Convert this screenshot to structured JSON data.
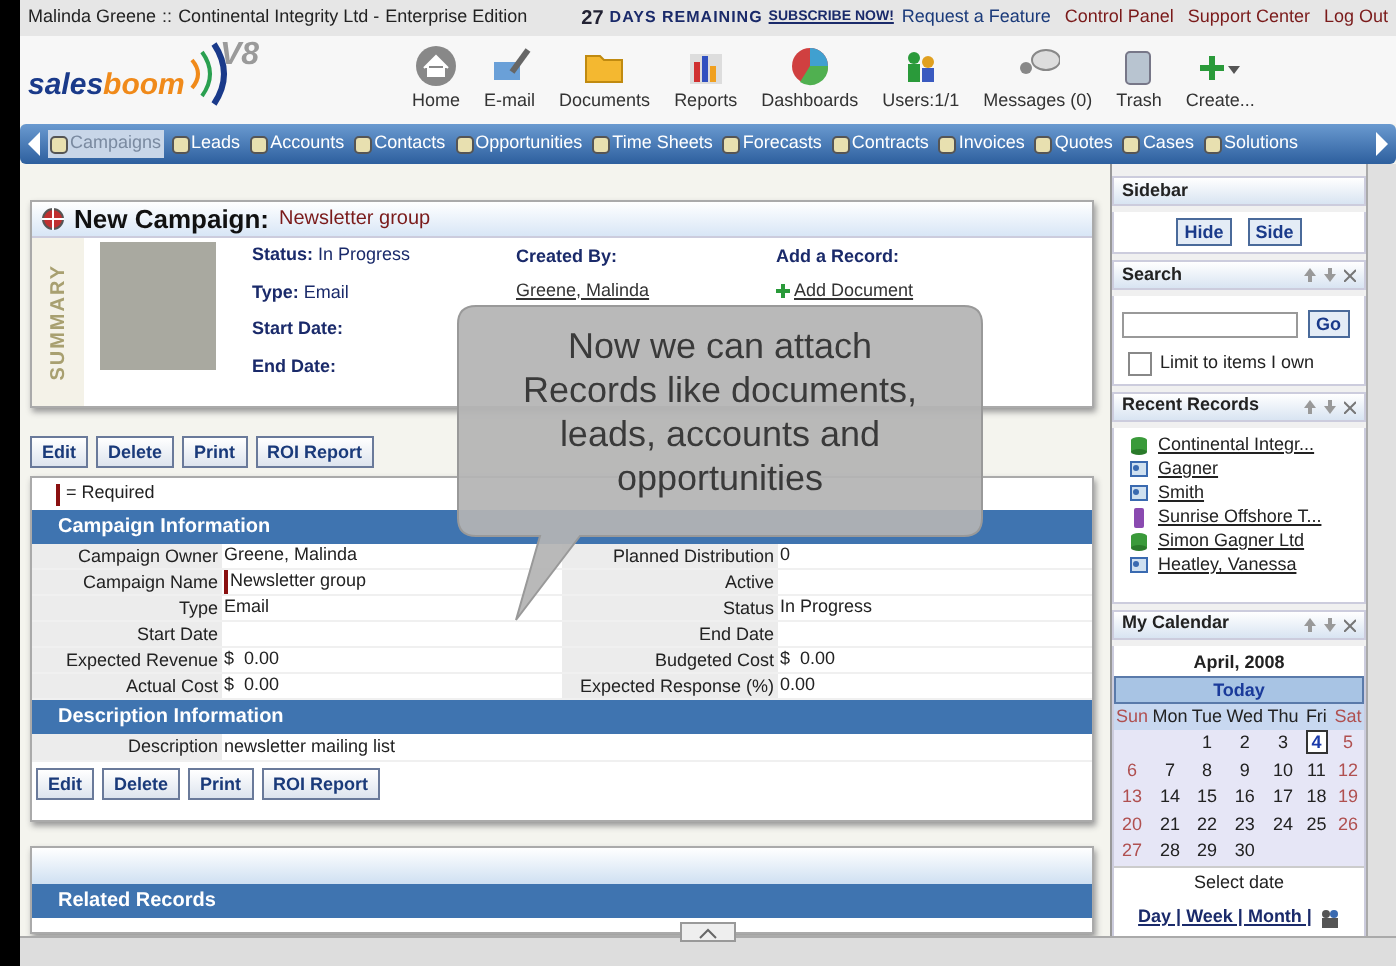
{
  "top_bar": {
    "user": "Malinda Greene",
    "separator": "::",
    "company": "Continental Integrity Ltd -",
    "edition": "Enterprise Edition",
    "trial_days": "27",
    "trial_label": "DAYS REMAINING",
    "subscribe": "SUBSCRIBE NOW!",
    "links": [
      {
        "label": "Request a Feature",
        "color": "#1a3a7a"
      },
      {
        "label": "Control Panel",
        "color": "#7a1a1a"
      },
      {
        "label": "Support Center",
        "color": "#7a1a1a"
      },
      {
        "label": "Log Out",
        "color": "#7a1a1a"
      }
    ]
  },
  "logo": {
    "watermark": "V8",
    "part_1": "sales",
    "part_2": "boom"
  },
  "toolbar": [
    {
      "kind": "home",
      "label": "Home"
    },
    {
      "kind": "email",
      "label": "E-mail"
    },
    {
      "kind": "folder",
      "label": "Documents"
    },
    {
      "kind": "bars",
      "label": "Reports"
    },
    {
      "kind": "pie",
      "label": "Dashboards"
    },
    {
      "kind": "users",
      "label": "Users:1/1"
    },
    {
      "kind": "messages",
      "label": "Messages (0)"
    },
    {
      "kind": "trash",
      "label": "Trash"
    },
    {
      "kind": "create",
      "label": "Create..."
    }
  ],
  "nav_tabs": [
    {
      "label": "Campaigns",
      "selected": true
    },
    {
      "label": "Leads",
      "selected": false
    },
    {
      "label": "Accounts",
      "selected": false
    },
    {
      "label": "Contacts",
      "selected": false
    },
    {
      "label": "Opportunities",
      "selected": false
    },
    {
      "label": "Time Sheets",
      "selected": false
    },
    {
      "label": "Forecasts",
      "selected": false
    },
    {
      "label": "Contracts",
      "selected": false
    },
    {
      "label": "Invoices",
      "selected": false
    },
    {
      "label": "Quotes",
      "selected": false
    },
    {
      "label": "Cases",
      "selected": false
    },
    {
      "label": "Solutions",
      "selected": false
    }
  ],
  "campaign": {
    "title": "New Campaign:",
    "name": "Newsletter group",
    "summary_label": "SUMMARY",
    "fields": [
      {
        "label": "Status:",
        "value": "In Progress"
      },
      {
        "label": "Type:",
        "value": "Email"
      },
      {
        "label": "Start Date:"
      },
      {
        "label": "End Date:"
      }
    ],
    "created_by_label": "Created By:",
    "created_by": "Greene, Malinda",
    "add_record_label": "Add a Record:",
    "add_record_links": [
      "Add Document"
    ]
  },
  "action_buttons_top": [
    "Edit",
    "Delete",
    "Print",
    "ROI Report"
  ],
  "required_note": "= Required",
  "campaign_information": {
    "title": "Campaign Information",
    "rows": [
      {
        "left": {
          "label": "Campaign Owner",
          "value": "Greene, Malinda",
          "required": false
        },
        "right": {
          "label": "Planned Distribution",
          "value": "0",
          "required": false
        }
      },
      {
        "left": {
          "label": "Campaign Name",
          "value": "Newsletter group",
          "required": true
        },
        "right": {
          "label": "Active",
          "required": false
        }
      },
      {
        "left": {
          "label": "Type",
          "value": "Email",
          "required": false
        },
        "right": {
          "label": "Status",
          "value": "In Progress",
          "required": false
        }
      },
      {
        "left": {
          "label": "Start Date",
          "required": false
        },
        "right": {
          "label": "End Date",
          "required": false
        }
      },
      {
        "left": {
          "label": "Expected Revenue",
          "value": "$  0.00",
          "required": false
        },
        "right": {
          "label": "Budgeted Cost",
          "value": "$  0.00",
          "required": false
        }
      },
      {
        "left": {
          "label": "Actual Cost",
          "value": "$  0.00",
          "required": false
        },
        "right": {
          "label": "Expected Response (%)",
          "value": "0.00",
          "required": false
        }
      }
    ]
  },
  "description_information": {
    "title": "Description Information",
    "rows": [
      {
        "label": "Description",
        "value": "newsletter mailing list"
      }
    ]
  },
  "action_buttons_bottom": [
    "Edit",
    "Delete",
    "Print",
    "ROI Report"
  ],
  "related_records": {
    "title": "Related Records"
  },
  "callout": "Now we can attach Records like documents, leads, accounts and opportunities",
  "sidebar": {
    "title": "Sidebar",
    "buttons": [
      "Hide",
      "Side"
    ],
    "search": {
      "title": "Search",
      "button": "Go",
      "checkbox_label": "Limit to items I own",
      "checked": false
    },
    "recent_records": {
      "title": "Recent Records",
      "items": [
        {
          "kind": "account",
          "label": "Continental Integr..."
        },
        {
          "kind": "contact",
          "label": "Gagner"
        },
        {
          "kind": "contact",
          "label": "Smith"
        },
        {
          "kind": "opportunity",
          "label": "Sunrise Offshore T..."
        },
        {
          "kind": "account",
          "label": "Simon Gagner Ltd"
        },
        {
          "kind": "contact",
          "label": "Heatley, Vanessa"
        }
      ]
    },
    "calendar": {
      "title": "My Calendar",
      "month": "April, 2008",
      "today": "Today",
      "weekdays": [
        "Sun",
        "Mon",
        "Tue",
        "Wed",
        "Thu",
        "Fri",
        "Sat"
      ],
      "weeks": [
        {
          "days": [
            {
              "day": "1",
              "selected": false
            },
            {
              "day": "2",
              "selected": false
            },
            {
              "day": "3",
              "selected": false
            },
            {
              "day": "4",
              "selected": true
            },
            {
              "day": "5",
              "selected": false
            }
          ]
        },
        {
          "days": [
            {
              "day": "6",
              "selected": false
            },
            {
              "day": "7",
              "selected": false
            },
            {
              "day": "8",
              "selected": false
            },
            {
              "day": "9",
              "selected": false
            },
            {
              "day": "10",
              "selected": false
            },
            {
              "day": "11",
              "selected": false
            },
            {
              "day": "12",
              "selected": false
            }
          ]
        },
        {
          "days": [
            {
              "day": "13",
              "selected": false
            },
            {
              "day": "14",
              "selected": false
            },
            {
              "day": "15",
              "selected": false
            },
            {
              "day": "16",
              "selected": false
            },
            {
              "day": "17",
              "selected": false
            },
            {
              "day": "18",
              "selected": false
            },
            {
              "day": "19",
              "selected": false
            }
          ]
        },
        {
          "days": [
            {
              "day": "20",
              "selected": false
            },
            {
              "day": "21",
              "selected": false
            },
            {
              "day": "22",
              "selected": false
            },
            {
              "day": "23",
              "selected": false
            },
            {
              "day": "24",
              "selected": false
            },
            {
              "day": "25",
              "selected": false
            },
            {
              "day": "26",
              "selected": false
            }
          ]
        },
        {
          "days": [
            {
              "day": "27",
              "selected": false
            },
            {
              "day": "28",
              "selected": false
            },
            {
              "day": "29",
              "selected": false
            },
            {
              "day": "30",
              "selected": false
            }
          ]
        }
      ],
      "select_label": "Select date",
      "views": "Day | Week | Month |"
    }
  }
}
